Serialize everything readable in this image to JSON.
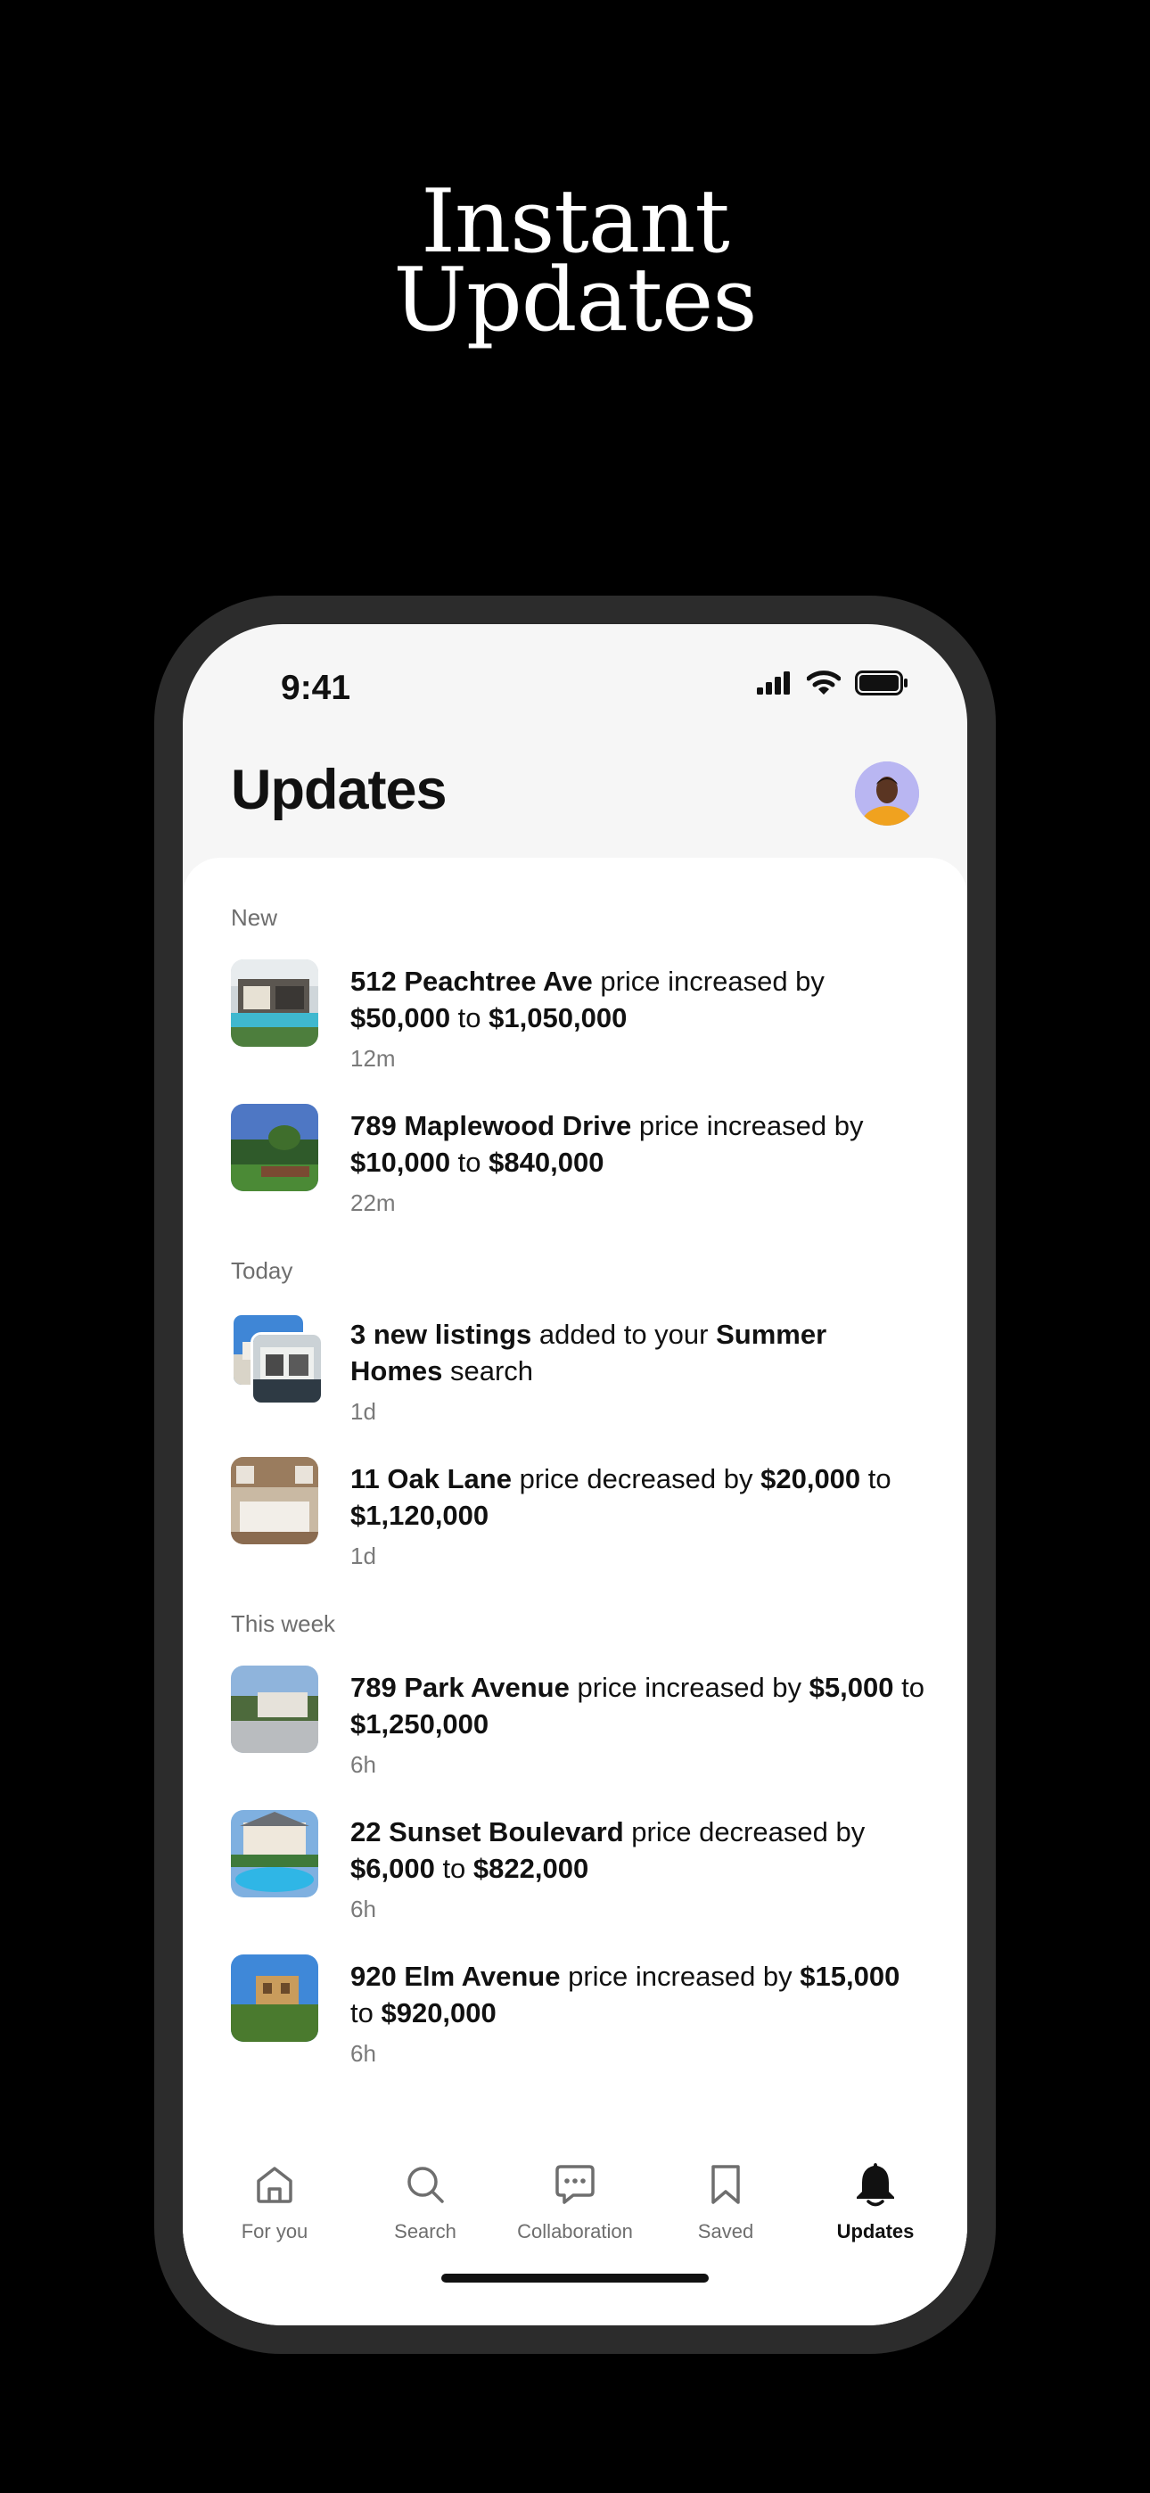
{
  "headline": {
    "line1": "Instant",
    "line2": "Updates"
  },
  "status_bar": {
    "time": "9:41"
  },
  "header": {
    "title": "Updates"
  },
  "sections": {
    "new": "New",
    "today": "Today",
    "this_week": "This week"
  },
  "items": [
    {
      "bold1": "512 Peachtree Ave",
      "t1": " price increased by ",
      "bold2": "$50,000",
      "t2": " to ",
      "bold3": "$1,050,000",
      "t3": "",
      "time": "12m"
    },
    {
      "bold1": "789 Maplewood Drive",
      "t1": " price increased by ",
      "bold2": "$10,000",
      "t2": " to ",
      "bold3": "$840,000",
      "t3": "",
      "time": "22m"
    },
    {
      "bold1": "3 new listings",
      "t1": " added to your ",
      "bold2": "Summer Homes",
      "t2": " search",
      "bold3": "",
      "t3": "",
      "time": "1d"
    },
    {
      "bold1": "11 Oak Lane",
      "t1": " price decreased by ",
      "bold2": "$20,000",
      "t2": " to ",
      "bold3": "$1,120,000",
      "t3": "",
      "time": "1d"
    },
    {
      "bold1": "789 Park Avenue",
      "t1": " price increased by ",
      "bold2": "$5,000",
      "t2": " to ",
      "bold3": "$1,250,000",
      "t3": "",
      "time": "6h"
    },
    {
      "bold1": "22 Sunset Boulevard",
      "t1": " price decreased by ",
      "bold2": "$6,000",
      "t2": " to ",
      "bold3": "$822,000",
      "t3": "",
      "time": "6h"
    },
    {
      "bold1": "920 Elm Avenue",
      "t1": " price increased by ",
      "bold2": "$15,000",
      "t2": " to ",
      "bold3": "$920,000",
      "t3": "",
      "time": "6h"
    }
  ],
  "tabs": [
    {
      "label": "For you",
      "icon": "home-icon"
    },
    {
      "label": "Search",
      "icon": "search-icon"
    },
    {
      "label": "Collaboration",
      "icon": "chat-icon"
    },
    {
      "label": "Saved",
      "icon": "bookmark-icon"
    },
    {
      "label": "Updates",
      "icon": "bell-icon",
      "active": true
    }
  ],
  "colors": {
    "background": "#000000",
    "phone_frame": "#2c2c2c",
    "accent": "#111111",
    "muted": "#6e6e6e"
  }
}
